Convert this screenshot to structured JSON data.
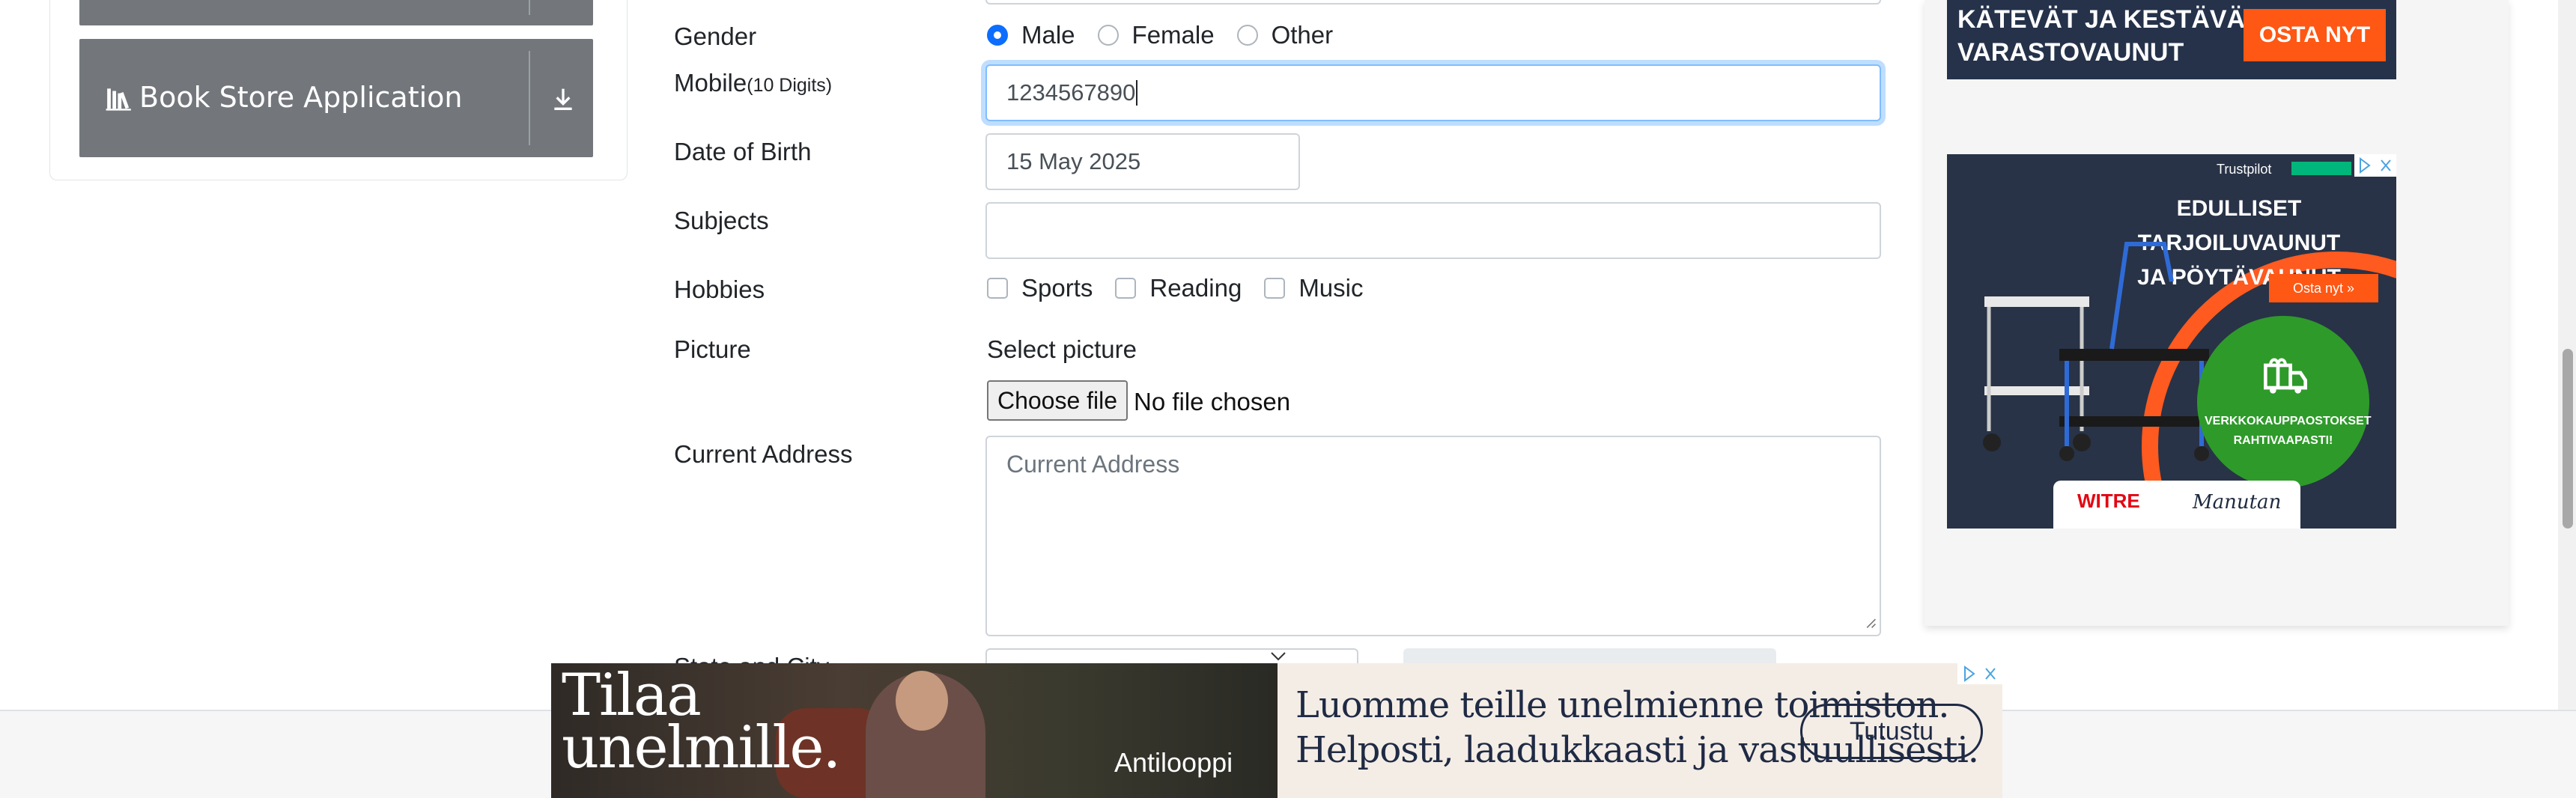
{
  "sidebar": {
    "book_store_label": "Book Store Application"
  },
  "form": {
    "gender": {
      "label": "Gender",
      "options": [
        "Male",
        "Female",
        "Other"
      ],
      "selected": "Male"
    },
    "mobile": {
      "label": "Mobile",
      "hint": "(10 Digits)",
      "value": "1234567890"
    },
    "dob": {
      "label": "Date of Birth",
      "value": "15 May 2025"
    },
    "subjects": {
      "label": "Subjects",
      "value": ""
    },
    "hobbies": {
      "label": "Hobbies",
      "options": [
        "Sports",
        "Reading",
        "Music"
      ]
    },
    "picture": {
      "label": "Picture",
      "select_label": "Select picture",
      "button_label": "Choose file",
      "status": "No file chosen"
    },
    "address": {
      "label": "Current Address",
      "placeholder": "Current Address"
    },
    "state_city": {
      "label": "State and City"
    }
  },
  "ads": {
    "top_ad": {
      "line1": "KÄTEVÄT JA KESTÄVÄT",
      "line2": "VARASTOVAUNUT",
      "cta": "OSTA NYT"
    },
    "side_ad": {
      "trustpilot": "Trustpilot",
      "headline1": "EDULLISET TARJOILUVAUNUT",
      "headline2": "JA PÖYTÄVAUNUT",
      "cta": "Osta nyt »",
      "badge1": "VERKKOKAUPPAOSTOKSET",
      "badge2": "RAHTIVAAPASTI!",
      "brand1": "WITRE",
      "brand2": "Manutan"
    },
    "bottom_banner": {
      "big1": "Tilaa",
      "big2": "unelmille.",
      "brand": "Antilooppi",
      "msg1": "Luomme teille unelmienne toimiston.",
      "msg2": "Helposti, laadukkaasti ja vastuullisesti.",
      "cta": "Tutustu"
    }
  },
  "colors": {
    "accent": "#0d6efd",
    "sidebar_item": "#73777c",
    "ad_orange": "#ff5714"
  }
}
